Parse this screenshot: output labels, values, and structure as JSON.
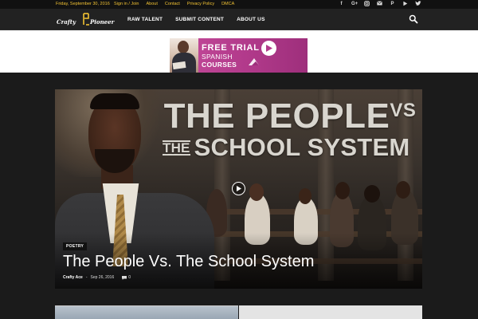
{
  "topbar": {
    "date": "Friday, September 30, 2016",
    "links": [
      "Sign in / Join",
      "About",
      "Contact",
      "Privacy Policy",
      "DMCA"
    ],
    "social_icons": [
      "facebook-icon",
      "google-plus-icon",
      "instagram-icon",
      "mail-icon",
      "pinterest-icon",
      "play-icon",
      "twitter-icon"
    ]
  },
  "logo": {
    "word1": "Crafty",
    "word2": "Pioneer"
  },
  "nav": {
    "items": [
      "RAW TALENT",
      "SUBMIT CONTENT",
      "ABOUT US"
    ]
  },
  "ad": {
    "line1": "FREE TRIAL",
    "line2": "SPANISH",
    "line3": "COURSES"
  },
  "hero": {
    "image_title_line1": "THE PEOPLE",
    "image_title_vs": "VS",
    "image_title_the": "THE",
    "image_title_line2": "SCHOOL SYSTEM",
    "category": "POETRY",
    "headline": "The People Vs. The School System",
    "author": "Crafty Ace",
    "separator": "-",
    "date": "Sep 26, 2016",
    "comments": "0"
  },
  "colors": {
    "accent": "#f2c233",
    "ad_bg": "#b23a8b",
    "page_bg": "#1b1b1b"
  }
}
